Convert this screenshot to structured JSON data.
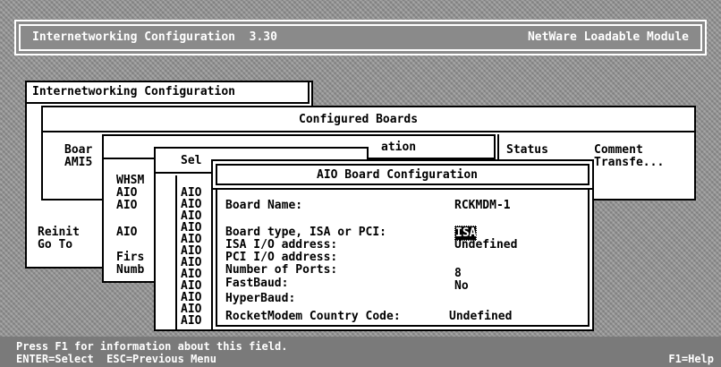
{
  "title_bar": {
    "left": "Internetworking Configuration  3.30",
    "right": "NetWare Loadable Module"
  },
  "main_menu": {
    "title": "Internetworking Configuration",
    "items": [
      "Reinit",
      "Go To"
    ]
  },
  "configured_boards": {
    "title": "Configured Boards",
    "headers": [
      "Boar",
      "Status",
      "Comment"
    ],
    "board": "AMI5",
    "comment": "Transfe..."
  },
  "board_list": {
    "title_frag": "ation",
    "rows": [
      "WHSM",
      "AIO",
      "AIO",
      "AIO",
      "Firs",
      "Numb"
    ]
  },
  "selector": {
    "title_frag": "Sel",
    "rows": [
      "AIO",
      "AIO",
      "AIO",
      "AIO",
      "AIO",
      "AIO",
      "AIO",
      "AIO",
      "AIO",
      "AIO",
      "AIO",
      "AIO"
    ]
  },
  "aio_dialog": {
    "title": "AIO Board Configuration",
    "fields": [
      {
        "label": "Board Name:",
        "value": "RCKMDM-1"
      },
      {
        "label": "Board type, ISA or PCI:",
        "value": "ISA"
      },
      {
        "label": "ISA I/O address:",
        "value": "Undefined"
      },
      {
        "label": "PCI I/O address:",
        "value": ""
      },
      {
        "label": "Number of Ports:",
        "value": "8"
      },
      {
        "label": "FastBaud:",
        "value": "No"
      },
      {
        "label": "HyperBaud:",
        "value": ""
      },
      {
        "label": "RocketModem Country Code:",
        "value": "Undefined"
      }
    ]
  },
  "status_bar": {
    "line1": "Press F1 for information about this field.",
    "line2": "ENTER=Select  ESC=Previous Menu",
    "help": "F1=Help"
  }
}
